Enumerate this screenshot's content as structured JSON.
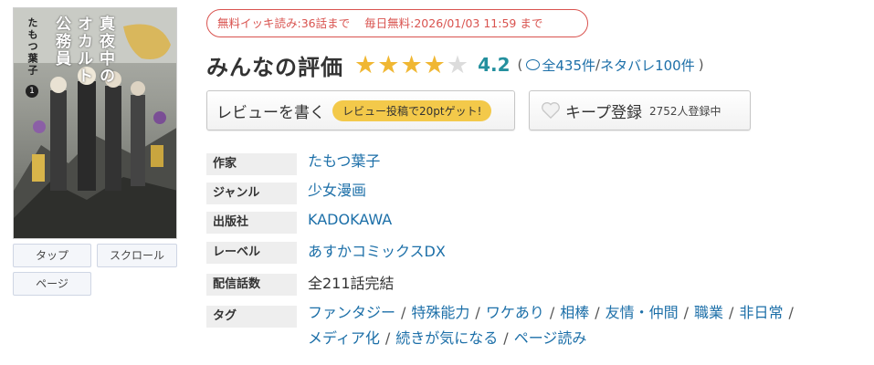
{
  "cover": {
    "title_lines": [
      "真夜中の",
      "オカルト",
      "公務員"
    ],
    "author": "たもつ葉子",
    "volume": "1"
  },
  "view_modes": [
    "タップ",
    "スクロール",
    "ページ"
  ],
  "free_info": {
    "binge": "無料イッキ読み:36話まで",
    "daily": "毎日無料:2026/01/03 11:59 まで",
    "accent_color": "#d9534f"
  },
  "rating": {
    "title": "みんなの評価",
    "score": "4.2",
    "stars_filled": 4,
    "stars_total": 5,
    "open_paren": "(",
    "total_reviews": "全435件",
    "separator": "/",
    "spoiler_reviews": "ネタバレ100件",
    "close_paren": ")",
    "star_color": "#f0b733",
    "score_color": "#24909e"
  },
  "actions": {
    "write_review": "レビューを書く",
    "review_bonus": "レビュー投稿で20ptゲット!",
    "keep": "キープ登録",
    "keep_count": "2752人登録中"
  },
  "info": {
    "rows": [
      {
        "label": "作家",
        "value": "たもつ葉子"
      },
      {
        "label": "ジャンル",
        "value": "少女漫画"
      },
      {
        "label": "出版社",
        "value": "KADOKAWA"
      },
      {
        "label": "レーベル",
        "value": "あすかコミックスDX"
      },
      {
        "label": "配信話数",
        "value": "全211話完結"
      },
      {
        "label": "タグ",
        "value": ""
      }
    ],
    "tags": [
      "ファンタジー",
      "特殊能力",
      "ワケあり",
      "相棒",
      "友情・仲間",
      "職業",
      "非日常",
      "メディア化",
      "続きが気になる",
      "ページ読み"
    ],
    "tag_separator": "/"
  }
}
